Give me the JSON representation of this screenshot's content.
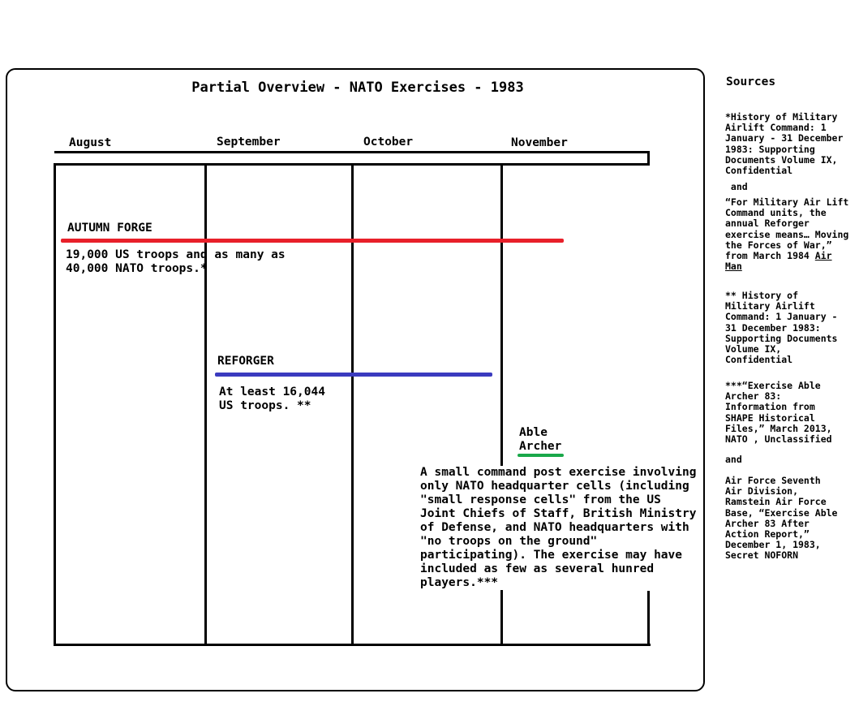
{
  "title": "Partial Overview - NATO Exercises - 1983",
  "months": [
    "August",
    "September",
    "October",
    "November"
  ],
  "exercises": {
    "autumn_forge": {
      "name": "AUTUMN FORGE",
      "note_line1": "19,000 US troops and as many as",
      "note_line2": "40,000 NATO troops.*",
      "color": "#e8202a"
    },
    "reforger": {
      "name": "REFORGER",
      "note_line1": "At least 16,044",
      "note_line2": "US troops. **",
      "color": "#3b3bbf"
    },
    "able_archer": {
      "name_line1": "Able",
      "name_line2": "Archer",
      "color": "#1aa84a",
      "note_lines": [
        "A small command post exercise involving",
        "only NATO headquarter cells (including",
        "\"small response cells\" from the US",
        "Joint Chiefs of Staff, British Ministry",
        "of Defense, and NATO headquarters with",
        "\"no troops on the ground\"",
        "participating). The exercise may have",
        "included as few as several hunred",
        "players.***"
      ]
    }
  },
  "sources": {
    "heading": "Sources",
    "s1_lines": [
      "*History of Military",
      "Airlift Command: 1",
      "January - 31 December",
      "1983: Supporting",
      "Documents Volume IX,",
      "Confidential"
    ],
    "and1": " and",
    "s2_lines": [
      "“For Military Air Lift",
      "Command units, the",
      "annual Reforger",
      "exercise means… Moving",
      "the Forces of War,”"
    ],
    "s2_from": "from March 1984 ",
    "s2_air": "Air",
    "s2_man": "Man",
    "s3_lines": [
      "** History of",
      "Military Airlift",
      "Command: 1 January -",
      "31 December 1983:",
      "Supporting Documents",
      "Volume IX,",
      "Confidential"
    ],
    "s4_lines": [
      "***“Exercise Able",
      "Archer 83:",
      "Information from",
      "SHAPE Historical",
      "Files,” March 2013,",
      "NATO , Unclassified"
    ],
    "and2": "and",
    "s5_lines": [
      "Air Force Seventh",
      "Air Division,",
      "Ramstein Air Force",
      "Base, “Exercise Able",
      "Archer 83 After",
      "Action Report,”",
      "December 1, 1983,",
      "Secret NOFORN"
    ]
  }
}
